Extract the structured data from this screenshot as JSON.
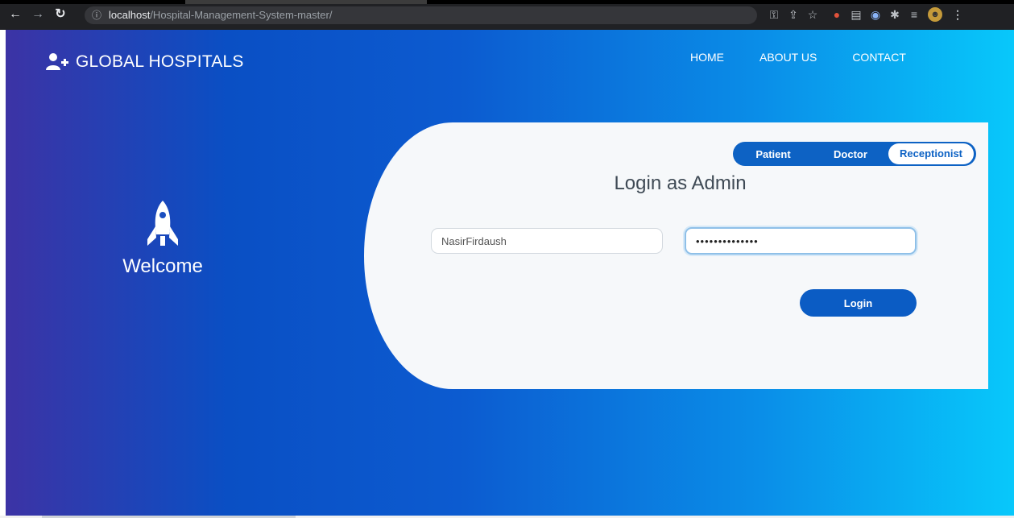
{
  "browser": {
    "url_host": "localhost",
    "url_path": "/Hospital-Management-System-master/",
    "icons": [
      "back-icon",
      "forward-icon",
      "reload-icon",
      "info-icon",
      "key-icon",
      "share-icon",
      "star-icon",
      "extension-icon",
      "puzzle-icon",
      "profile-icon"
    ]
  },
  "header": {
    "brand": "GLOBAL HOSPITALS",
    "nav": [
      "HOME",
      "ABOUT US",
      "CONTACT"
    ]
  },
  "hero": {
    "welcome": "Welcome"
  },
  "login": {
    "tabs": [
      "Patient",
      "Doctor",
      "Receptionist"
    ],
    "active_tab": "Receptionist",
    "heading": "Login as Admin",
    "username_value": "NasirFirdaush",
    "password_value": "nasirfirdaush1",
    "button": "Login"
  },
  "colors": {
    "gradient_start": "#3c33a5",
    "gradient_end": "#08c8fb",
    "accent": "#0d62c4"
  }
}
